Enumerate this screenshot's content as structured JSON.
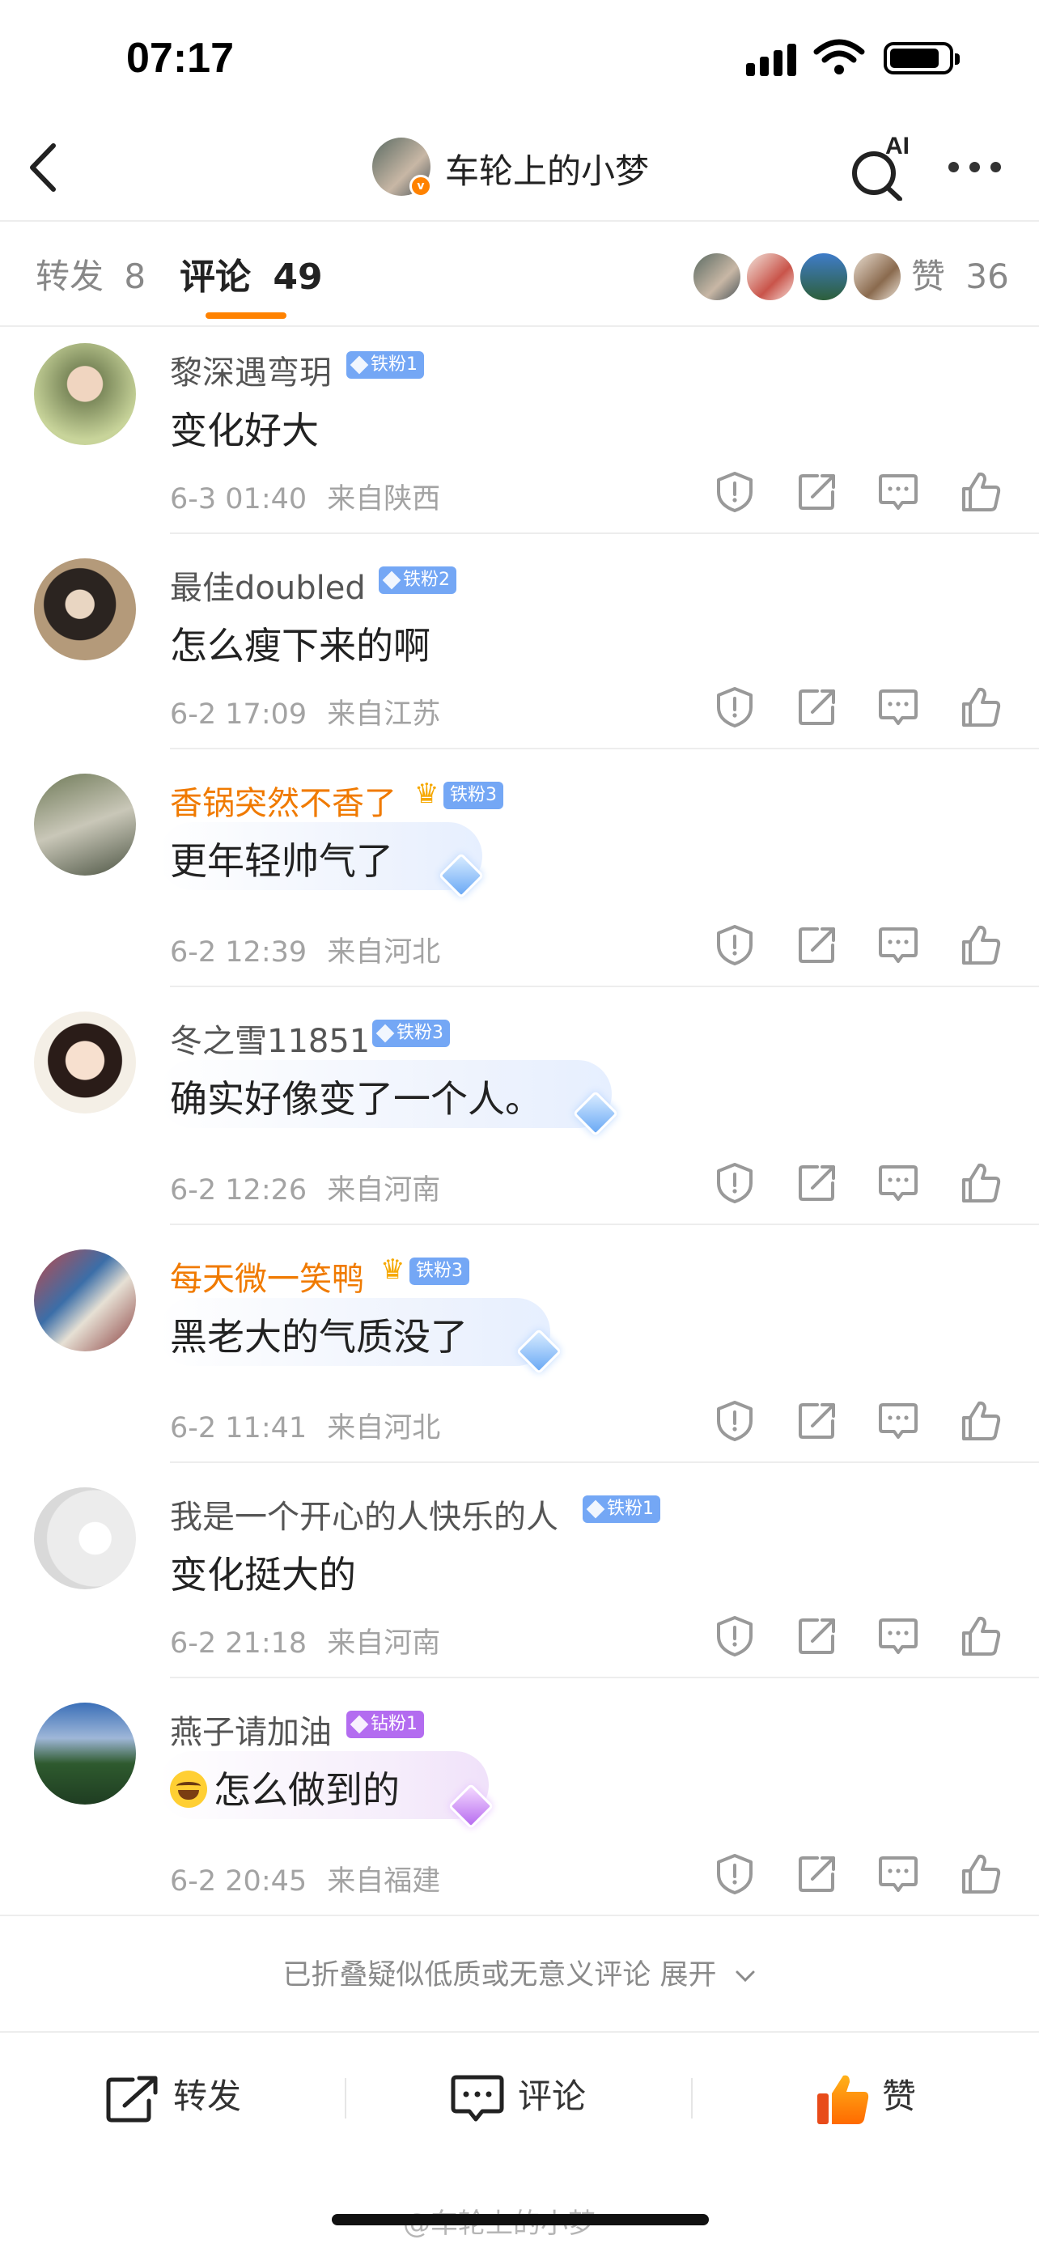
{
  "status_bar": {
    "time": "07:17"
  },
  "header": {
    "title": "车轮上的小梦",
    "ai_label": "AI"
  },
  "tabs": {
    "repost_label": "转发",
    "repost_count": "8",
    "comment_label": "评论",
    "comment_count": "49",
    "like_label": "赞",
    "like_count": "36"
  },
  "comments": [
    {
      "name": "黎深遇弯玥",
      "badge": "铁粉1",
      "text": "变化好大",
      "time": "6-3 01:40",
      "location": "来自陕西"
    },
    {
      "name": "最佳doubled",
      "badge": "铁粉2",
      "text": "怎么瘦下来的啊",
      "time": "6-2 17:09",
      "location": "来自江苏"
    },
    {
      "name": "香锅突然不香了",
      "badge": "铁粉3",
      "text": "更年轻帅气了",
      "time": "6-2 12:39",
      "location": "来自河北"
    },
    {
      "name": "冬之雪11851",
      "badge": "铁粉3",
      "text": "确实好像变了一个人。",
      "time": "6-2 12:26",
      "location": "来自河南"
    },
    {
      "name": "每天微一笑鸭",
      "badge": "铁粉3",
      "text": "黑老大的气质没了",
      "time": "6-2 11:41",
      "location": "来自河北"
    },
    {
      "name": "我是一个开心的人快乐的人",
      "badge": "铁粉1",
      "text": "变化挺大的",
      "time": "6-2 21:18",
      "location": "来自河南"
    },
    {
      "name": "燕子请加油",
      "badge": "钻粉1",
      "text": "怎么做到的",
      "time": "6-2 20:45",
      "location": "来自福建"
    }
  ],
  "collapsed_note": "已折叠疑似低质或无意义评论 展开",
  "bottom_bar": {
    "repost": "转发",
    "comment": "评论",
    "like": "赞"
  },
  "watermark": "@车轮上的小梦",
  "colors": {
    "accent": "#ff8200",
    "vip_name": "#f07a00",
    "fan_badge": "#74a7f5",
    "diamond_badge": "#b36cf0"
  }
}
